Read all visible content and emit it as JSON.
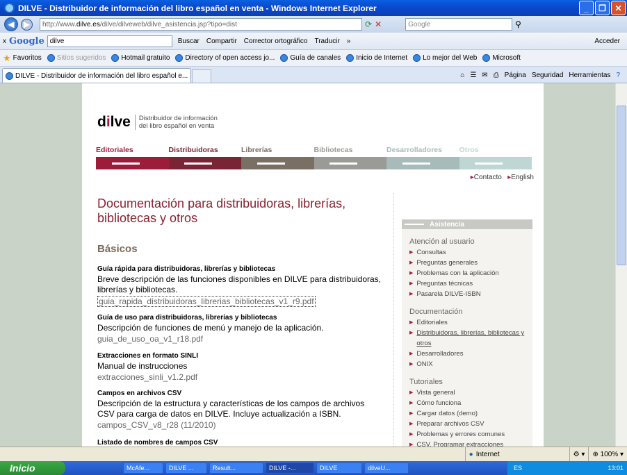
{
  "window": {
    "title": "DILVE - Distribuidor de información del libro español en venta - Windows Internet Explorer"
  },
  "address": {
    "url_pre": "http://www.",
    "url_domain": "dilve.es",
    "url_post": "/dilve/dilveweb/dilve_asistencia.jsp?tipo=dist",
    "search_placeholder": "Google"
  },
  "googlebar": {
    "brand": "Google",
    "query": "dilve",
    "items": [
      "Buscar",
      "Compartir",
      "Corrector ortográfico",
      "Traducir",
      "»",
      "Acceder"
    ]
  },
  "favorites": {
    "label": "Favoritos",
    "items": [
      "Sitios sugeridos",
      "Hotmail gratuito",
      "Directory of open access jo...",
      "Guía de canales",
      "Inicio de Internet",
      "Lo mejor del Web",
      "Microsoft"
    ]
  },
  "tab": {
    "label": "DILVE - Distribuidor de información del libro español e..."
  },
  "commands": [
    "Página",
    "Seguridad",
    "Herramientas"
  ],
  "site": {
    "logo": "dilve",
    "logo_sub_1": "Distribuidor de información",
    "logo_sub_2": "del libro español en venta",
    "categories": [
      {
        "label": "Editoriales",
        "color": "#9c1d3a"
      },
      {
        "label": "Distribuidoras",
        "color": "#7a2535"
      },
      {
        "label": "Librerías",
        "color": "#7a6f63"
      },
      {
        "label": "Bibliotecas",
        "color": "#9a9b97"
      },
      {
        "label": "Desarrolladores",
        "color": "#a8bbbb"
      },
      {
        "label": "Otros",
        "color": "#bfd7d4"
      }
    ],
    "contact": "Contacto",
    "english": "English",
    "heading": "Documentación para distribuidoras, librerías, bibliotecas y otros",
    "section": "Básicos",
    "docs": [
      {
        "title": "Guía rápida para distribuidoras, librerías y bibliotecas",
        "desc": "Breve descripción de las funciones disponibles en DILVE para distribuidoras, librerías y bibliotecas.",
        "file": "guia_rapida_distribuidoras_librerias_bibliotecas_v1_r9.pdf"
      },
      {
        "title": "Guía de uso para distribuidoras, librerías y bibliotecas",
        "desc": "Descripción de funciones de menú y manejo de la aplicación.",
        "file": "guia_de_uso_oa_v1_r18.pdf"
      },
      {
        "title": "Extracciones en formato SINLI",
        "desc": "Manual de instrucciones",
        "file": "extracciones_sinli_v1.2.pdf"
      },
      {
        "title": "Campos en archivos CSV",
        "desc": "Descripción de la estructura y características de los campos de archivos CSV para carga de datos en DILVE. Incluye actualización a ISBN.",
        "file": "campos_CSV_v8_r28 (11/2010)"
      },
      {
        "title": "Listado de nombres de campos CSV",
        "desc": "",
        "file": ""
      }
    ],
    "sidebar": {
      "header": "Asistencia",
      "groups": [
        {
          "title": "Atención al usuario",
          "items": [
            "Consultas",
            "Preguntas generales",
            "Problemas con la aplicación",
            "Preguntas técnicas",
            "Pasarela DILVE-ISBN"
          ]
        },
        {
          "title": "Documentación",
          "items": [
            "Editoriales",
            "Distribuidoras, librerías, bibliotecas y otros",
            "Desarrolladores",
            "ONIX"
          ]
        },
        {
          "title": "Tutoriales",
          "items": [
            "Vista general",
            "Cómo funciona",
            "Cargar datos (demo)",
            "Preparar archivos CSV",
            "Problemas y errores comunes",
            "CSV. Programar extracciones"
          ]
        }
      ]
    }
  },
  "status": {
    "zone": "Internet",
    "zoom": "100%"
  },
  "taskbar": {
    "start": "Inicio",
    "buttons": [
      "McAfe...",
      "DILVE ...",
      "Result...",
      "DILVE -...",
      "DILVE",
      "dilveU..."
    ],
    "lang": "ES",
    "clock": "13:01"
  }
}
